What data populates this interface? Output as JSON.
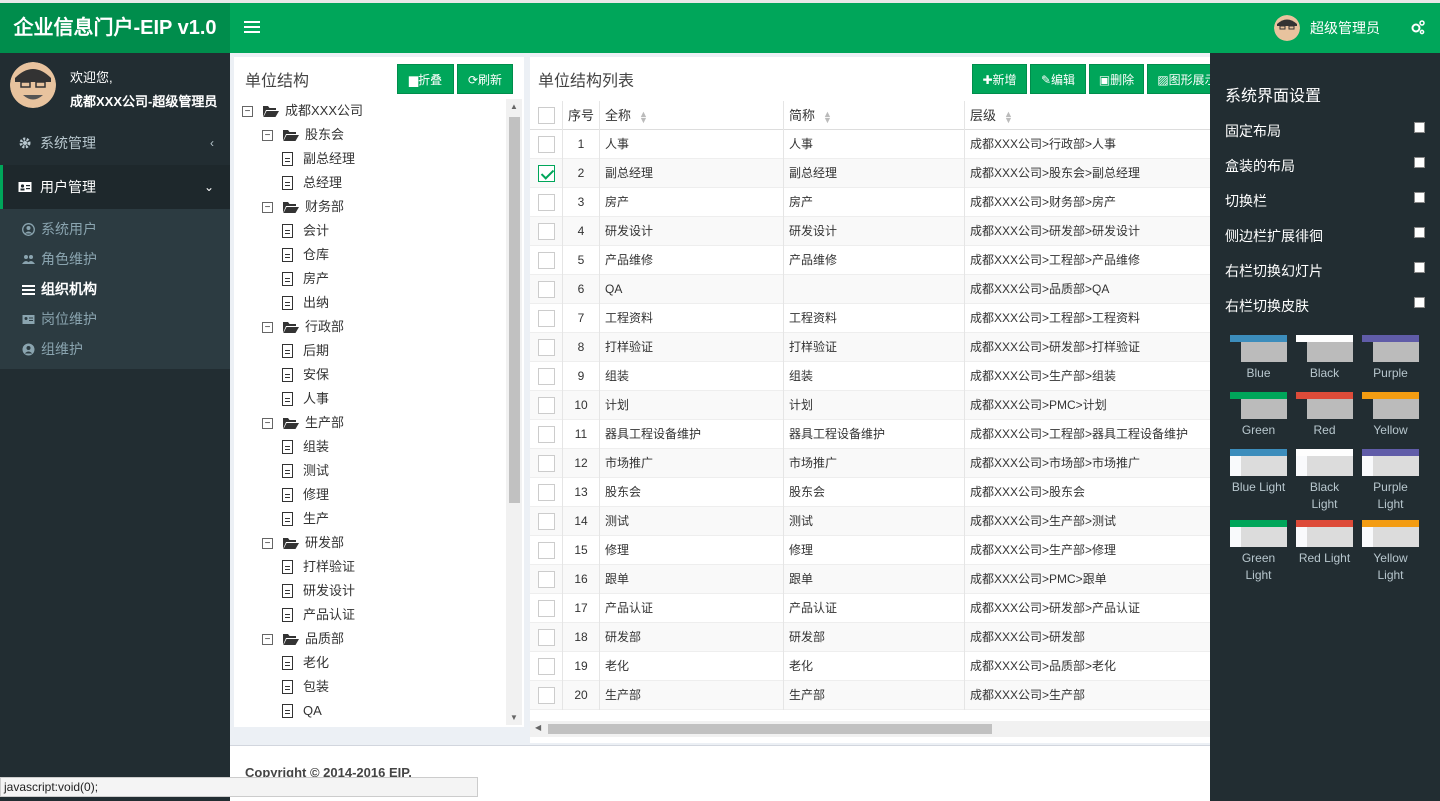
{
  "header": {
    "logo": "企业信息门户-EIP v1.0",
    "user_name": "超级管理员"
  },
  "sidebar": {
    "welcome": "欢迎您,",
    "user": "成都XXX公司-超级管理员",
    "menu": [
      {
        "label": "系统管理",
        "icon": "gear-icon",
        "arrow": "‹"
      },
      {
        "label": "用户管理",
        "icon": "id-card-icon",
        "arrow": "⌄"
      }
    ],
    "submenu": [
      {
        "label": "系统用户",
        "icon": "user-circle-icon"
      },
      {
        "label": "角色维护",
        "icon": "users-icon"
      },
      {
        "label": "组织机构",
        "icon": "list-icon"
      },
      {
        "label": "岗位维护",
        "icon": "id-card-icon"
      },
      {
        "label": "组维护",
        "icon": "user-circle-icon"
      }
    ]
  },
  "tree_panel": {
    "title": "单位结构",
    "collapse_label": "折叠",
    "refresh_label": "刷新",
    "nodes": [
      {
        "label": "成都XXX公司",
        "level": 0,
        "type": "folder"
      },
      {
        "label": "股东会",
        "level": 1,
        "type": "folder"
      },
      {
        "label": "副总经理",
        "level": 2,
        "type": "doc"
      },
      {
        "label": "总经理",
        "level": 2,
        "type": "doc"
      },
      {
        "label": "财务部",
        "level": 1,
        "type": "folder"
      },
      {
        "label": "会计",
        "level": 2,
        "type": "doc"
      },
      {
        "label": "仓库",
        "level": 2,
        "type": "doc"
      },
      {
        "label": "房产",
        "level": 2,
        "type": "doc"
      },
      {
        "label": "出纳",
        "level": 2,
        "type": "doc"
      },
      {
        "label": "行政部",
        "level": 1,
        "type": "folder"
      },
      {
        "label": "后期",
        "level": 2,
        "type": "doc"
      },
      {
        "label": "安保",
        "level": 2,
        "type": "doc"
      },
      {
        "label": "人事",
        "level": 2,
        "type": "doc"
      },
      {
        "label": "生产部",
        "level": 1,
        "type": "folder"
      },
      {
        "label": "组装",
        "level": 2,
        "type": "doc"
      },
      {
        "label": "测试",
        "level": 2,
        "type": "doc"
      },
      {
        "label": "修理",
        "level": 2,
        "type": "doc"
      },
      {
        "label": "生产",
        "level": 2,
        "type": "doc"
      },
      {
        "label": "研发部",
        "level": 1,
        "type": "folder"
      },
      {
        "label": "打样验证",
        "level": 2,
        "type": "doc"
      },
      {
        "label": "研发设计",
        "level": 2,
        "type": "doc"
      },
      {
        "label": "产品认证",
        "level": 2,
        "type": "doc"
      },
      {
        "label": "品质部",
        "level": 1,
        "type": "folder"
      },
      {
        "label": "老化",
        "level": 2,
        "type": "doc"
      },
      {
        "label": "包装",
        "level": 2,
        "type": "doc"
      },
      {
        "label": "QA",
        "level": 2,
        "type": "doc"
      }
    ]
  },
  "table_panel": {
    "title": "单位结构列表",
    "buttons": {
      "add": "新增",
      "edit": "编辑",
      "delete": "删除",
      "graph": "图形展示"
    },
    "columns": {
      "index": "序号",
      "name": "全称",
      "short": "简称",
      "level": "层级"
    },
    "rows": [
      {
        "i": "1",
        "name": "人事",
        "short": "人事",
        "level": "成都XXX公司>行政部>人事",
        "checked": false
      },
      {
        "i": "2",
        "name": "副总经理",
        "short": "副总经理",
        "level": "成都XXX公司>股东会>副总经理",
        "checked": true
      },
      {
        "i": "3",
        "name": "房产",
        "short": "房产",
        "level": "成都XXX公司>财务部>房产",
        "checked": false
      },
      {
        "i": "4",
        "name": "研发设计",
        "short": "研发设计",
        "level": "成都XXX公司>研发部>研发设计",
        "checked": false
      },
      {
        "i": "5",
        "name": "产品维修",
        "short": "产品维修",
        "level": "成都XXX公司>工程部>产品维修",
        "checked": false
      },
      {
        "i": "6",
        "name": "QA",
        "short": "",
        "level": "成都XXX公司>品质部>QA",
        "checked": false
      },
      {
        "i": "7",
        "name": "工程资料",
        "short": "工程资料",
        "level": "成都XXX公司>工程部>工程资料",
        "checked": false
      },
      {
        "i": "8",
        "name": "打样验证",
        "short": "打样验证",
        "level": "成都XXX公司>研发部>打样验证",
        "checked": false
      },
      {
        "i": "9",
        "name": "组装",
        "short": "组装",
        "level": "成都XXX公司>生产部>组装",
        "checked": false
      },
      {
        "i": "10",
        "name": "计划",
        "short": "计划",
        "level": "成都XXX公司>PMC>计划",
        "checked": false
      },
      {
        "i": "11",
        "name": "器具工程设备维护",
        "short": "器具工程设备维护",
        "level": "成都XXX公司>工程部>器具工程设备维护",
        "checked": false
      },
      {
        "i": "12",
        "name": "市场推广",
        "short": "市场推广",
        "level": "成都XXX公司>市场部>市场推广",
        "checked": false
      },
      {
        "i": "13",
        "name": "股东会",
        "short": "股东会",
        "level": "成都XXX公司>股东会",
        "checked": false
      },
      {
        "i": "14",
        "name": "测试",
        "short": "测试",
        "level": "成都XXX公司>生产部>测试",
        "checked": false
      },
      {
        "i": "15",
        "name": "修理",
        "short": "修理",
        "level": "成都XXX公司>生产部>修理",
        "checked": false
      },
      {
        "i": "16",
        "name": "跟单",
        "short": "跟单",
        "level": "成都XXX公司>PMC>跟单",
        "checked": false
      },
      {
        "i": "17",
        "name": "产品认证",
        "short": "产品认证",
        "level": "成都XXX公司>研发部>产品认证",
        "checked": false
      },
      {
        "i": "18",
        "name": "研发部",
        "short": "研发部",
        "level": "成都XXX公司>研发部",
        "checked": false
      },
      {
        "i": "19",
        "name": "老化",
        "short": "老化",
        "level": "成都XXX公司>品质部>老化",
        "checked": false
      },
      {
        "i": "20",
        "name": "生产部",
        "short": "生产部",
        "level": "成都XXX公司>生产部",
        "checked": false
      }
    ]
  },
  "control_sidebar": {
    "title": "系统界面设置",
    "options": [
      "固定布局",
      "盒装的布局",
      "切换栏",
      "侧边栏扩展徘徊",
      "右栏切换幻灯片",
      "右栏切换皮肤"
    ],
    "skins": [
      {
        "label": "Blue",
        "a": "#367fa9",
        "b": "#3c8dbc",
        "c": "#222d32"
      },
      {
        "label": "Black",
        "a": "#fefefe",
        "b": "#fefefe",
        "c": "#222d32"
      },
      {
        "label": "Purple",
        "a": "#555299",
        "b": "#605ca8",
        "c": "#222d32"
      },
      {
        "label": "Green",
        "a": "#008d4c",
        "b": "#00a65a",
        "c": "#222d32"
      },
      {
        "label": "Red",
        "a": "#dd4b39",
        "b": "#dd4b39",
        "c": "#222d32"
      },
      {
        "label": "Yellow",
        "a": "#db8b0b",
        "b": "#f39c12",
        "c": "#222d32"
      },
      {
        "label": "Blue Light",
        "a": "#367fa9",
        "b": "#3c8dbc",
        "c": "#f9fafc"
      },
      {
        "label": "Black Light",
        "a": "#fefefe",
        "b": "#fefefe",
        "c": "#f9fafc"
      },
      {
        "label": "Purple Light",
        "a": "#555299",
        "b": "#605ca8",
        "c": "#f9fafc"
      },
      {
        "label": "Green Light",
        "a": "#008d4c",
        "b": "#00a65a",
        "c": "#f9fafc"
      },
      {
        "label": "Red Light",
        "a": "#dd4b39",
        "b": "#dd4b39",
        "c": "#f9fafc"
      },
      {
        "label": "Yellow Light",
        "a": "#db8b0b",
        "b": "#f39c12",
        "c": "#f9fafc"
      }
    ]
  },
  "footer": {
    "copyright": "Copyright © 2014-2016 EIP."
  },
  "statusbar": {
    "text": "javascript:void(0);"
  }
}
